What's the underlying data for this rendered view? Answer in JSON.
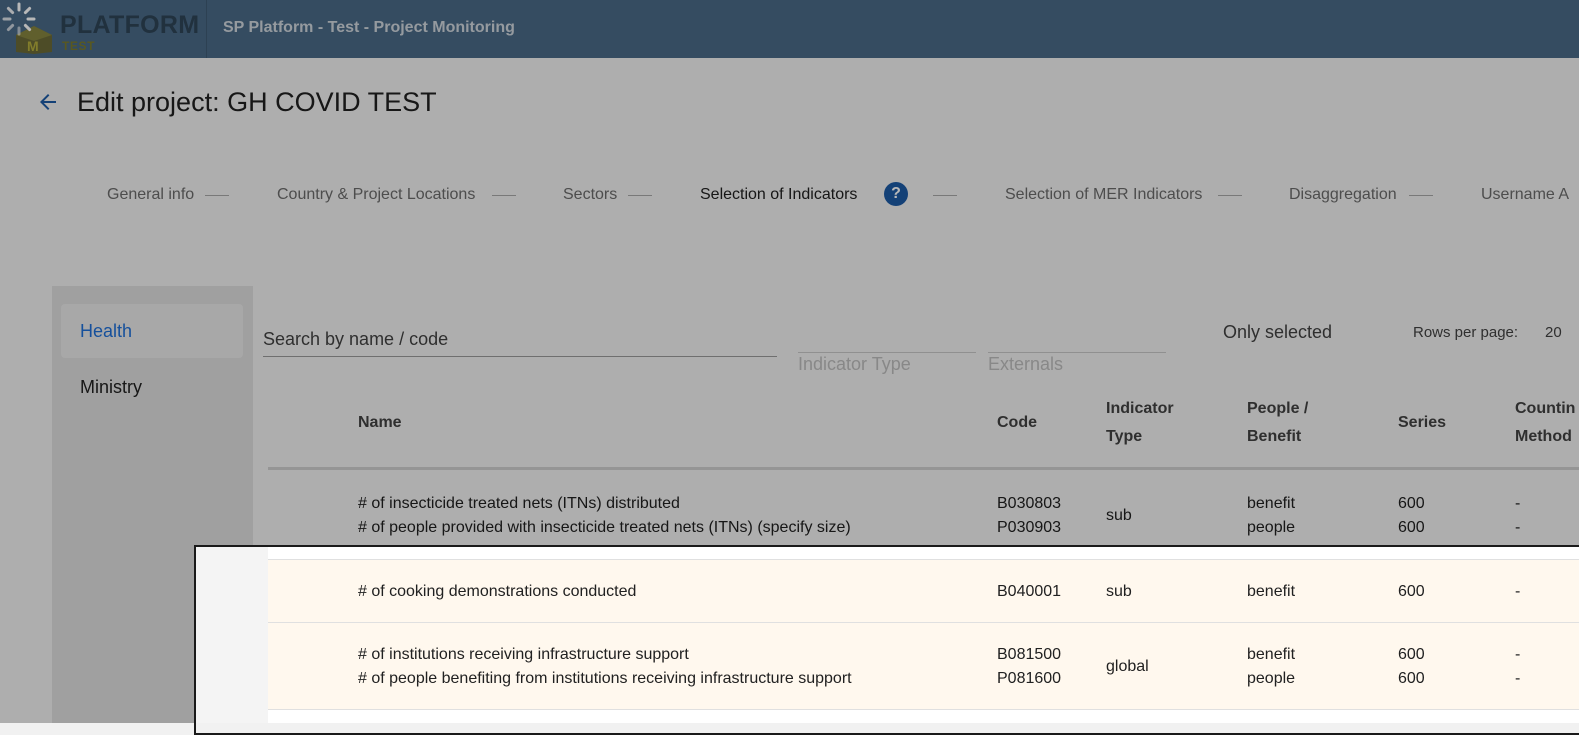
{
  "header": {
    "logo_text": "PLATFORM",
    "logo_sub": "TEST",
    "app_title": "SP Platform - Test - Project Monitoring"
  },
  "page": {
    "title": "Edit project: GH COVID TEST"
  },
  "stepper": {
    "steps": [
      {
        "label": "General info"
      },
      {
        "label": "Country & Project Locations"
      },
      {
        "label": "Sectors"
      },
      {
        "label": "Selection of Indicators"
      },
      {
        "label": "Selection of MER Indicators"
      },
      {
        "label": "Disaggregation"
      },
      {
        "label": "Username A"
      }
    ],
    "help": "?"
  },
  "sidebar": {
    "items": [
      {
        "label": "Health"
      },
      {
        "label": "Ministry"
      }
    ]
  },
  "filters": {
    "search_placeholder": "Search by name / code",
    "indicator_type_label": "Indicator Type",
    "externals_label": "Externals",
    "only_selected_label": "Only selected",
    "rows_per_page_label": "Rows per page:",
    "rows_per_page_value": "20"
  },
  "table": {
    "headers": {
      "name": "Name",
      "code": "Code",
      "indicator_type_1": "Indicator",
      "indicator_type_2": "Type",
      "people_benefit_1": "People /",
      "people_benefit_2": "Benefit",
      "series": "Series",
      "counting_1": "Countin",
      "counting_2": "Method"
    },
    "rows": [
      {
        "name_1": "# of insecticide treated nets (ITNs) distributed",
        "name_2": "# of people provided with insecticide treated nets (ITNs) (specify size)",
        "code_1": "B030803",
        "code_2": "P030903",
        "type": "sub",
        "pb_1": "benefit",
        "pb_2": "people",
        "series_1": "600",
        "series_2": "600",
        "count_1": "-",
        "count_2": "-"
      },
      {
        "name_1": "# of cooking demonstrations conducted",
        "code_1": "B040001",
        "type": "sub",
        "pb_1": "benefit",
        "series_1": "600",
        "count_1": "-"
      },
      {
        "name_1": "# of institutions receiving infrastructure support",
        "name_2": "# of people benefiting from institutions receiving infrastructure support",
        "code_1": "B081500",
        "code_2": "P081600",
        "type": "global",
        "pb_1": "benefit",
        "pb_2": "people",
        "series_1": "600",
        "series_2": "600",
        "count_1": "-",
        "count_2": "-"
      }
    ]
  }
}
